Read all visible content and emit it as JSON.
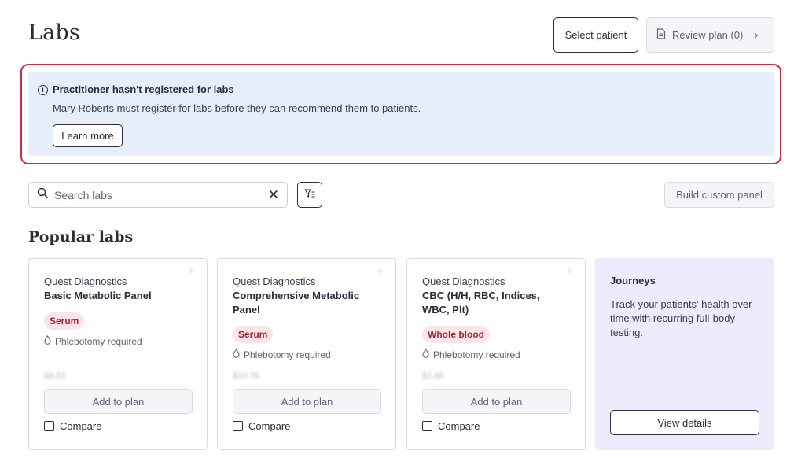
{
  "header": {
    "title": "Labs",
    "select_patient": "Select patient",
    "review_plan": "Review plan (0)"
  },
  "alert": {
    "title": "Practitioner hasn't registered for labs",
    "body": "Mary Roberts must register for labs before they can recommend them to patients.",
    "learn_more": "Learn more"
  },
  "search": {
    "placeholder": "Search labs"
  },
  "toolbar": {
    "build_custom_panel": "Build custom panel"
  },
  "popular": {
    "title": "Popular labs",
    "cards": [
      {
        "vendor": "Quest Diagnostics",
        "name": "Basic Metabolic Panel",
        "tag": "Serum",
        "requirement": "Phlebotomy required",
        "price": "$8.63",
        "add_label": "Add to plan",
        "compare_label": "Compare"
      },
      {
        "vendor": "Quest Diagnostics",
        "name": "Comprehensive Metabolic Panel",
        "tag": "Serum",
        "requirement": "Phlebotomy required",
        "price": "$10.78",
        "add_label": "Add to plan",
        "compare_label": "Compare"
      },
      {
        "vendor": "Quest Diagnostics",
        "name": "CBC (H/H, RBC, Indices, WBC, Plt)",
        "tag": "Whole blood",
        "requirement": "Phlebotomy required",
        "price": "$2.88",
        "add_label": "Add to plan",
        "compare_label": "Compare"
      }
    ],
    "journeys": {
      "title": "Journeys",
      "body": "Track your patients' health over time with recurring full-body testing.",
      "button": "View details"
    }
  },
  "colors": {
    "alert_bg": "#e6eefa",
    "alert_outline": "#c72f48",
    "tag_bg": "#fbe5e8",
    "tag_text": "#a3253b",
    "journeys_bg": "#efebfc"
  }
}
